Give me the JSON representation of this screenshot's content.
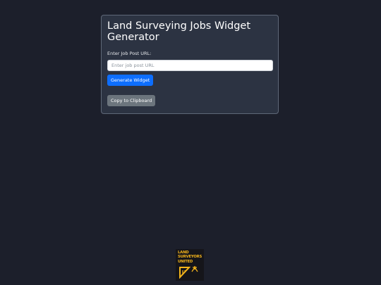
{
  "card": {
    "title": "Land Surveying Jobs Widget Generator",
    "url_label": "Enter Job Post URL:",
    "url_input": {
      "value": "",
      "placeholder": "Enter job post URL"
    },
    "generate_button": "Generate Widget",
    "copy_button": "Copy to Clipboard"
  },
  "logo": {
    "lines": [
      "LAND",
      "SURVEYORS",
      "UNITED"
    ],
    "icon": "survey-tripod-icon",
    "brand_color": "#f4b41a"
  },
  "colors": {
    "background": "#1c1f2b",
    "card": "#2c3342",
    "primary_button": "#0d6efd",
    "secondary_button": "#6c757d"
  }
}
